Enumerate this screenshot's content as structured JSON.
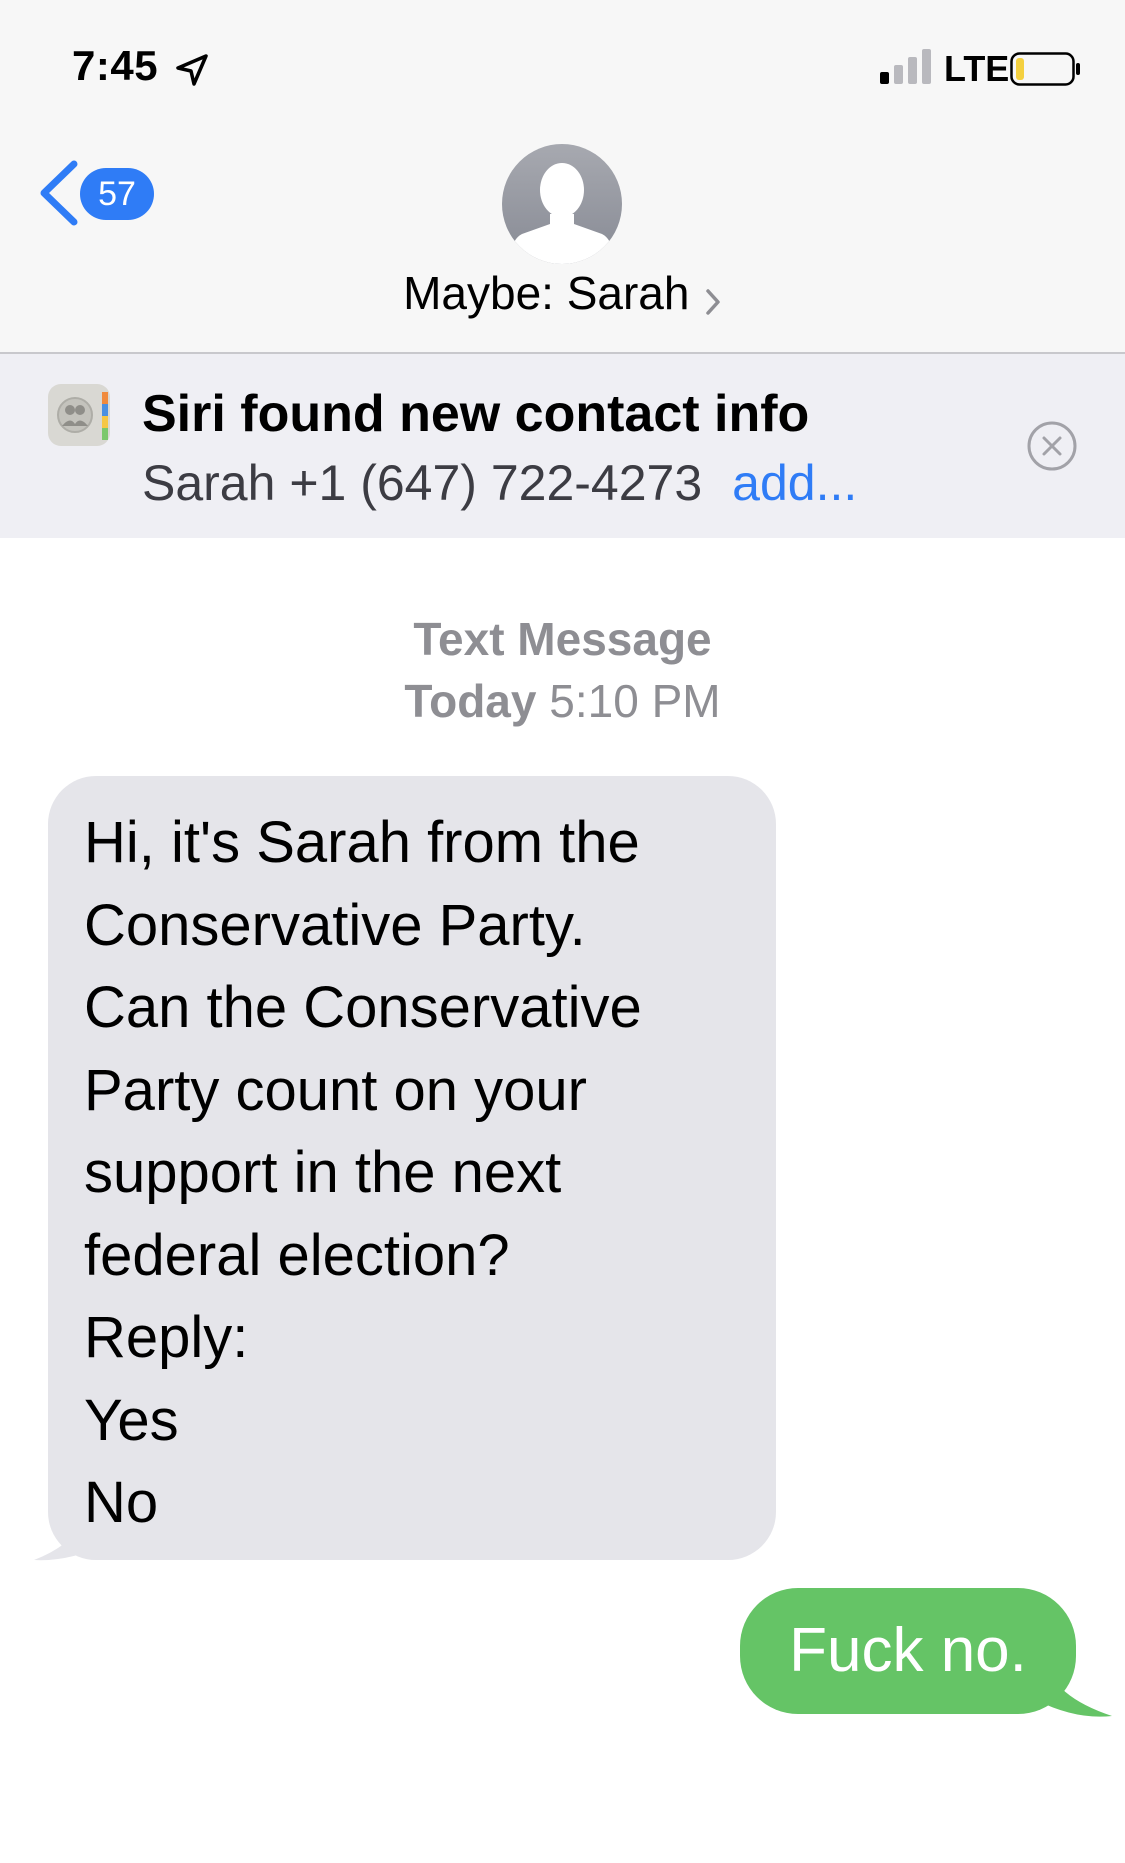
{
  "status_bar": {
    "time": "7:45",
    "network": "LTE",
    "icons": [
      "location-arrow-icon",
      "signal-icon",
      "battery-icon"
    ]
  },
  "header": {
    "back_badge_count": "57",
    "contact_name": "Maybe: Sarah",
    "icons": [
      "back-chevron-icon",
      "avatar-silhouette-icon",
      "chevron-right-icon"
    ]
  },
  "siri_suggestion": {
    "title": "Siri found new contact info",
    "details": "Sarah +1 (647) 722-4273",
    "action": "add...",
    "icons": [
      "contacts-app-icon",
      "close-circle-icon"
    ]
  },
  "conversation": {
    "service_label": "Text Message",
    "day": "Today",
    "time": "5:10 PM",
    "messages": [
      {
        "direction": "incoming",
        "lines": [
          "Hi, it's Sarah from the",
          "Conservative Party.",
          "Can the Conservative",
          "Party count on your",
          "support in the next",
          "federal election?",
          "Reply:",
          "Yes",
          "No"
        ]
      },
      {
        "direction": "outgoing",
        "text": "Fuck no."
      }
    ]
  },
  "colors": {
    "ios_blue": "#2f7cf6",
    "incoming_bubble": "#e5e5ea",
    "outgoing_bubble": "#65c466",
    "meta_gray": "#8e8e93",
    "battery_low": "#f4d03f"
  }
}
